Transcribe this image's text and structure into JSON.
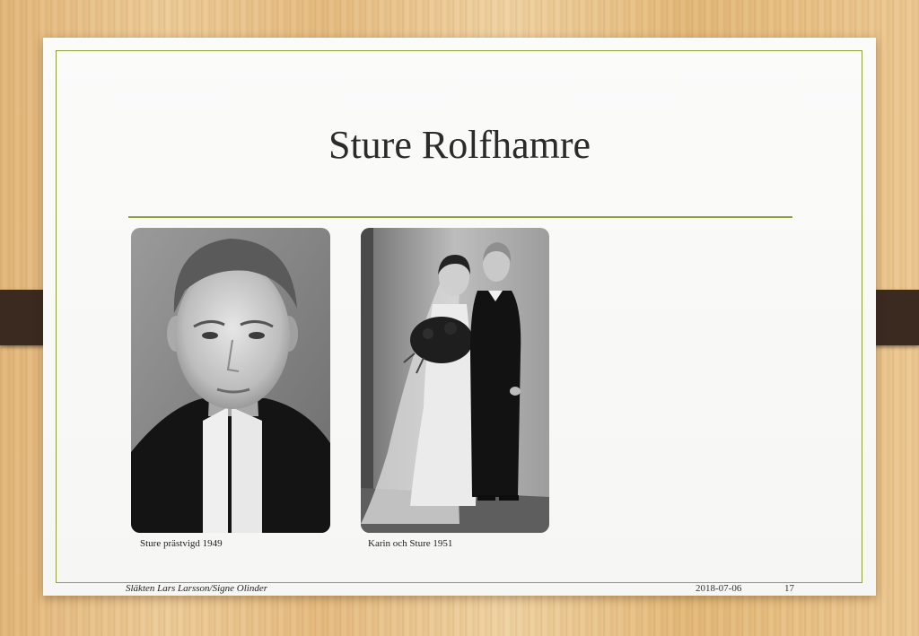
{
  "slide": {
    "title": "Sture Rolfhamre"
  },
  "photos": [
    {
      "caption": "Sture prästvigd 1949"
    },
    {
      "caption": "Karin och Sture 1951"
    }
  ],
  "footer": {
    "text": "Släkten Lars Larsson/Signe Olinder",
    "date": "2018-07-06",
    "page": "17"
  },
  "colors": {
    "accent": "#8da03c",
    "clip": "#3a2a20"
  }
}
